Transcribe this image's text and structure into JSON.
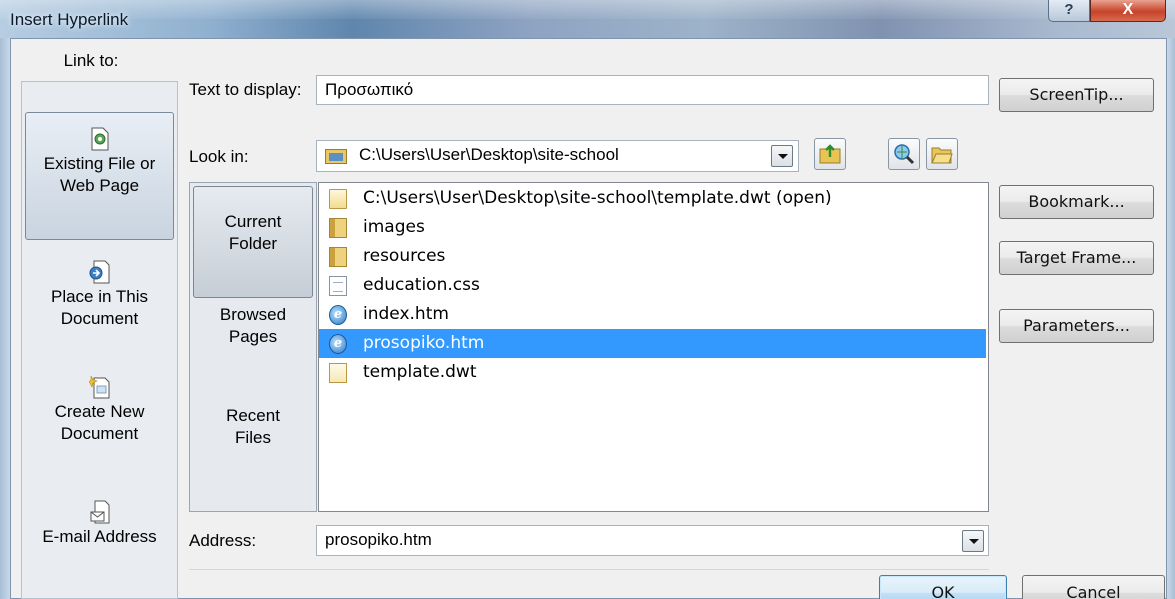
{
  "window": {
    "title": "Insert Hyperlink",
    "help_glyph": "?",
    "close_glyph": "X"
  },
  "link_to": {
    "label": "Link to:",
    "items": [
      {
        "label_line1": "Existing File or",
        "label_line2": "Web Page",
        "icon": "web-page-icon",
        "selected": true
      },
      {
        "label_line1": "Place in This",
        "label_line2": "Document",
        "icon": "place-in-document-icon",
        "selected": false
      },
      {
        "label_line1": "Create New",
        "label_line2": "Document",
        "icon": "new-document-icon",
        "selected": false
      },
      {
        "label_line1": "E-mail Address",
        "label_line2": "",
        "icon": "email-icon",
        "selected": false
      }
    ]
  },
  "text_to_display": {
    "label": "Text to display:",
    "value": "Προσωπικό"
  },
  "look_in": {
    "label": "Look in:",
    "value": "C:\\Users\\User\\Desktop\\site-school"
  },
  "places": [
    {
      "line1": "Current",
      "line2": "Folder",
      "selected": true
    },
    {
      "line1": "Browsed",
      "line2": "Pages",
      "selected": false
    },
    {
      "line1": "Recent",
      "line2": "Files",
      "selected": false
    }
  ],
  "files": [
    {
      "name": "C:\\Users\\User\\Desktop\\site-school\\template.dwt (open)",
      "icon": "open-file-icon",
      "selected": false
    },
    {
      "name": "images",
      "icon": "folder-icon",
      "selected": false
    },
    {
      "name": "resources",
      "icon": "folder-icon",
      "selected": false
    },
    {
      "name": "education.css",
      "icon": "css-file-icon",
      "selected": false
    },
    {
      "name": "index.htm",
      "icon": "ie-page-icon",
      "selected": false
    },
    {
      "name": "prosopiko.htm",
      "icon": "ie-page-icon",
      "selected": true
    },
    {
      "name": "template.dwt",
      "icon": "template-file-icon",
      "selected": false
    }
  ],
  "address": {
    "label": "Address:",
    "value": "prosopiko.htm"
  },
  "side_buttons": {
    "screentip": "ScreenTip...",
    "bookmark": "Bookmark...",
    "target_frame": "Target Frame...",
    "parameters": "Parameters..."
  },
  "footer": {
    "ok": "OK",
    "cancel": "Cancel"
  },
  "colors": {
    "selection": "#3399ff",
    "default_button": "#bedff5"
  }
}
